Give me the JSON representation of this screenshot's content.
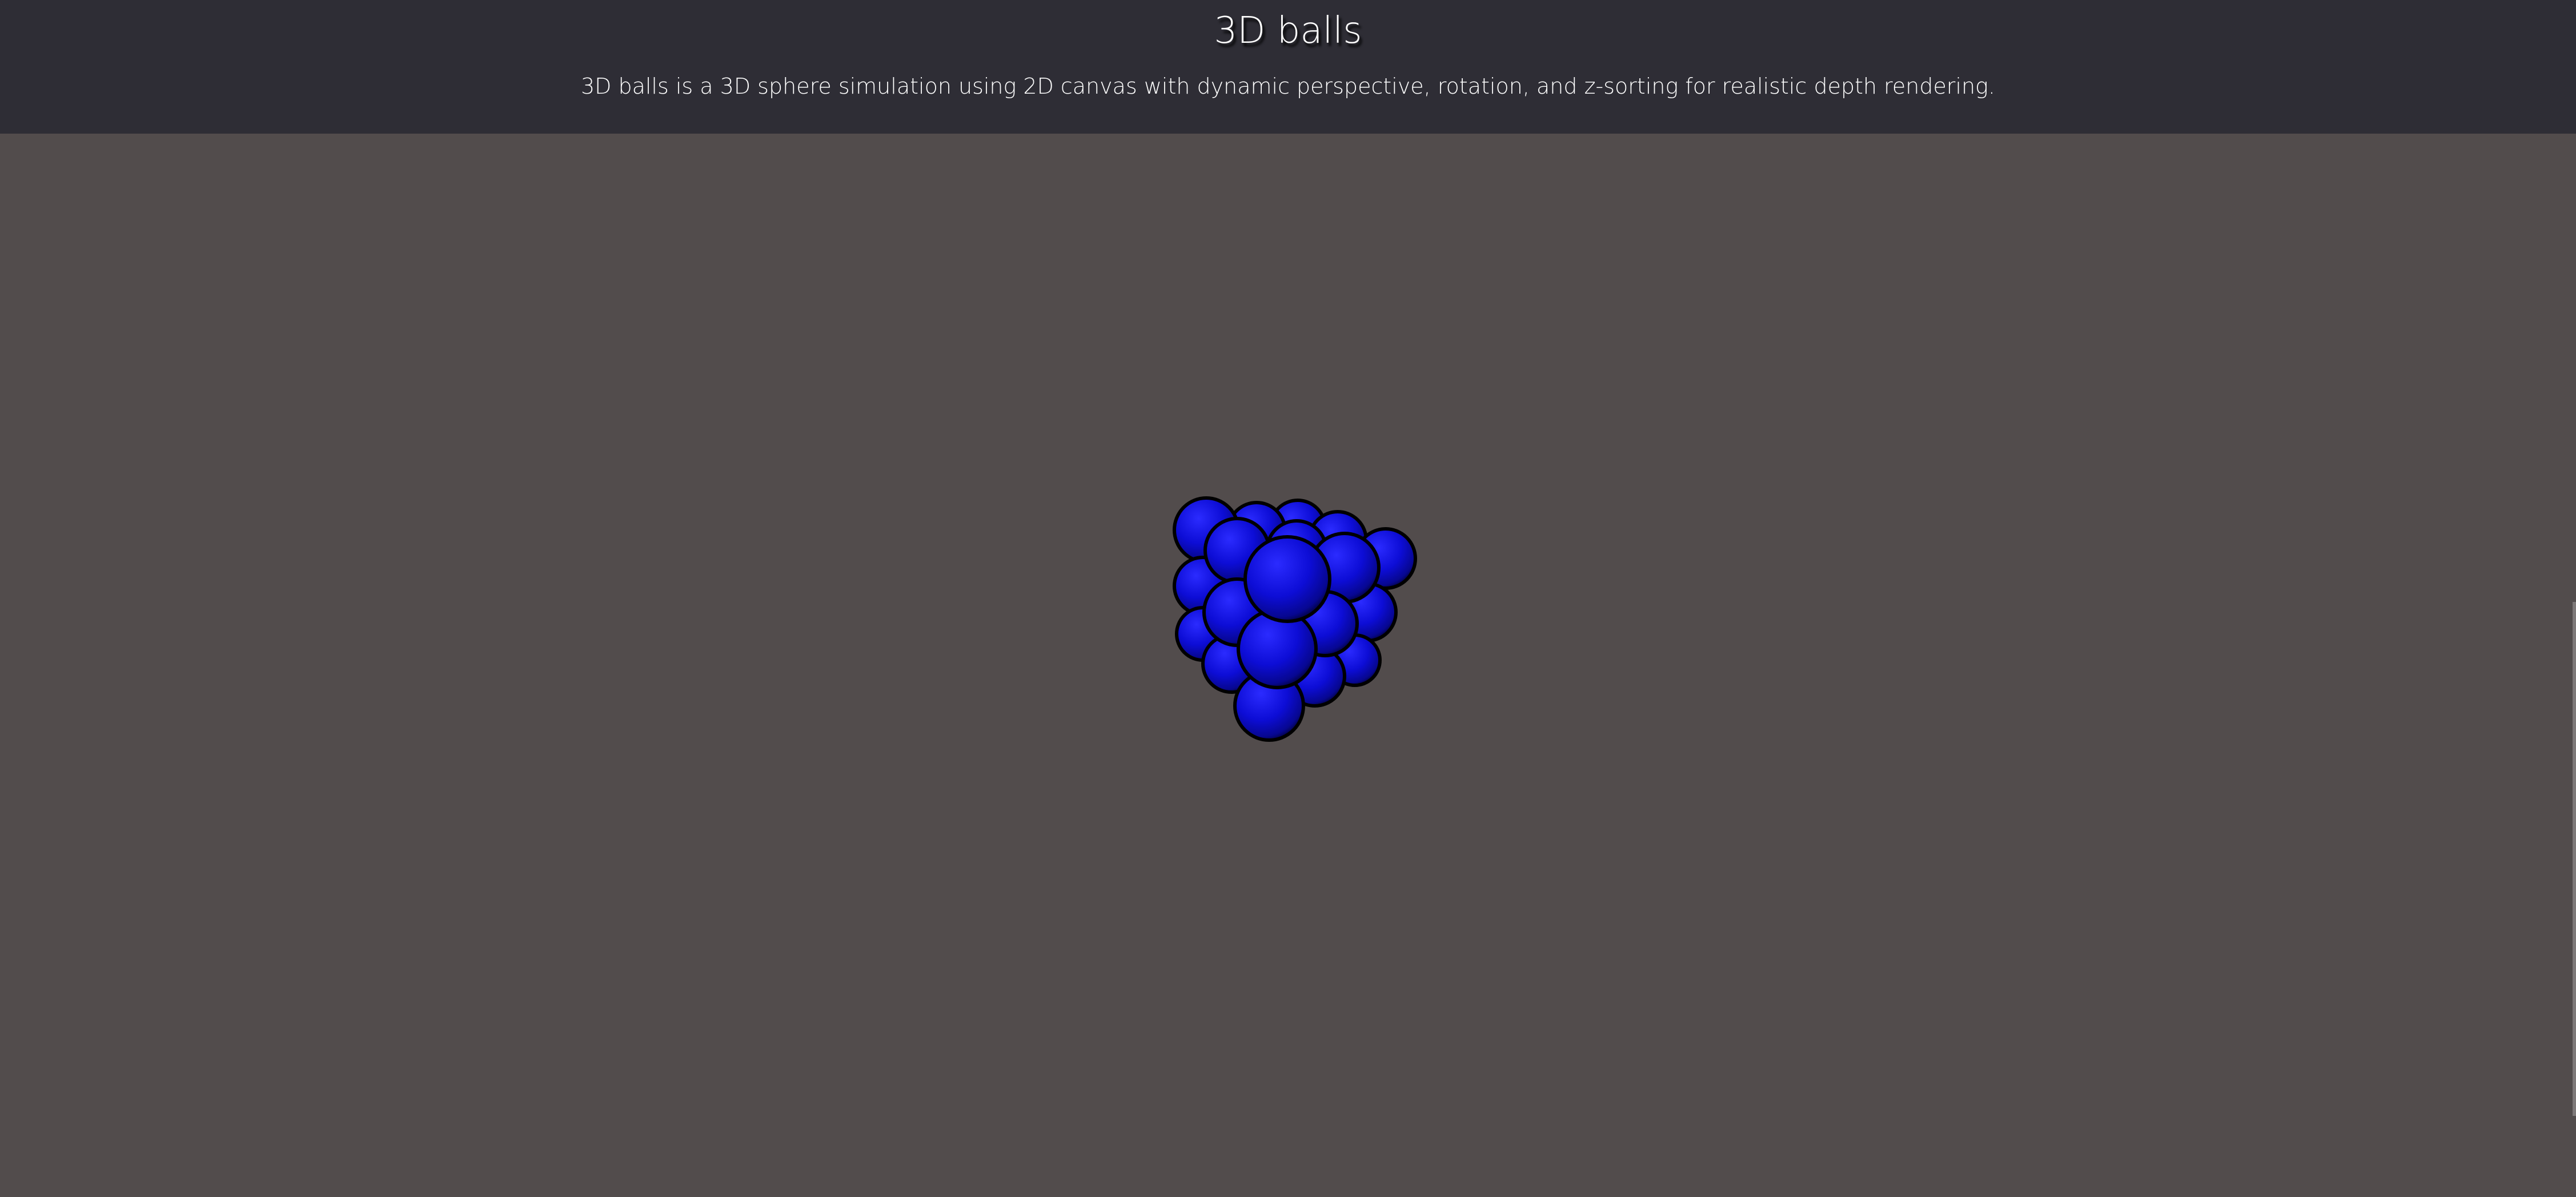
{
  "page": {
    "title": "3D balls",
    "description": "3D balls is a 3D sphere simulation using 2D canvas with dynamic perspective, rotation, and z-sorting for realistic depth rendering."
  },
  "colors": {
    "header_background": "#2e2d35",
    "stage_background": "#524c4c",
    "sphere_color": "#0000cc",
    "sphere_outline": "#000000",
    "text": "#ffffff"
  }
}
